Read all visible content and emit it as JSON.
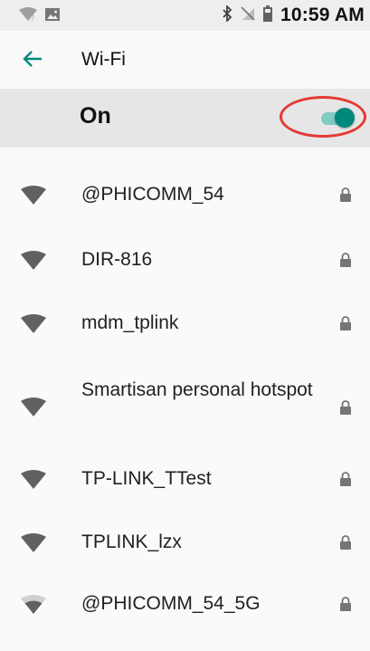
{
  "status_bar": {
    "time": "10:59 AM",
    "icons": [
      "wifi-question-icon",
      "image-notification-icon",
      "bluetooth-icon",
      "no-sim-icon",
      "battery-icon"
    ]
  },
  "app_bar": {
    "back_icon": "arrow-back-icon",
    "title": "Wi-Fi"
  },
  "master_switch": {
    "label": "On",
    "checked": true,
    "accent_color": "#00897b",
    "highlight_color": "#e53935"
  },
  "networks": [
    {
      "ssid": "@PHICOMM_54",
      "secured": true,
      "signal": "full"
    },
    {
      "ssid": "DIR-816",
      "secured": true,
      "signal": "full"
    },
    {
      "ssid": "mdm_tplink",
      "secured": true,
      "signal": "full"
    },
    {
      "ssid": "Smartisan personal hotspot",
      "secured": true,
      "signal": "full"
    },
    {
      "ssid": "TP-LINK_TTest",
      "secured": true,
      "signal": "full"
    },
    {
      "ssid": "TPLINK_lzx",
      "secured": true,
      "signal": "full"
    },
    {
      "ssid": "@PHICOMM_54_5G",
      "secured": true,
      "signal": "partial"
    }
  ]
}
